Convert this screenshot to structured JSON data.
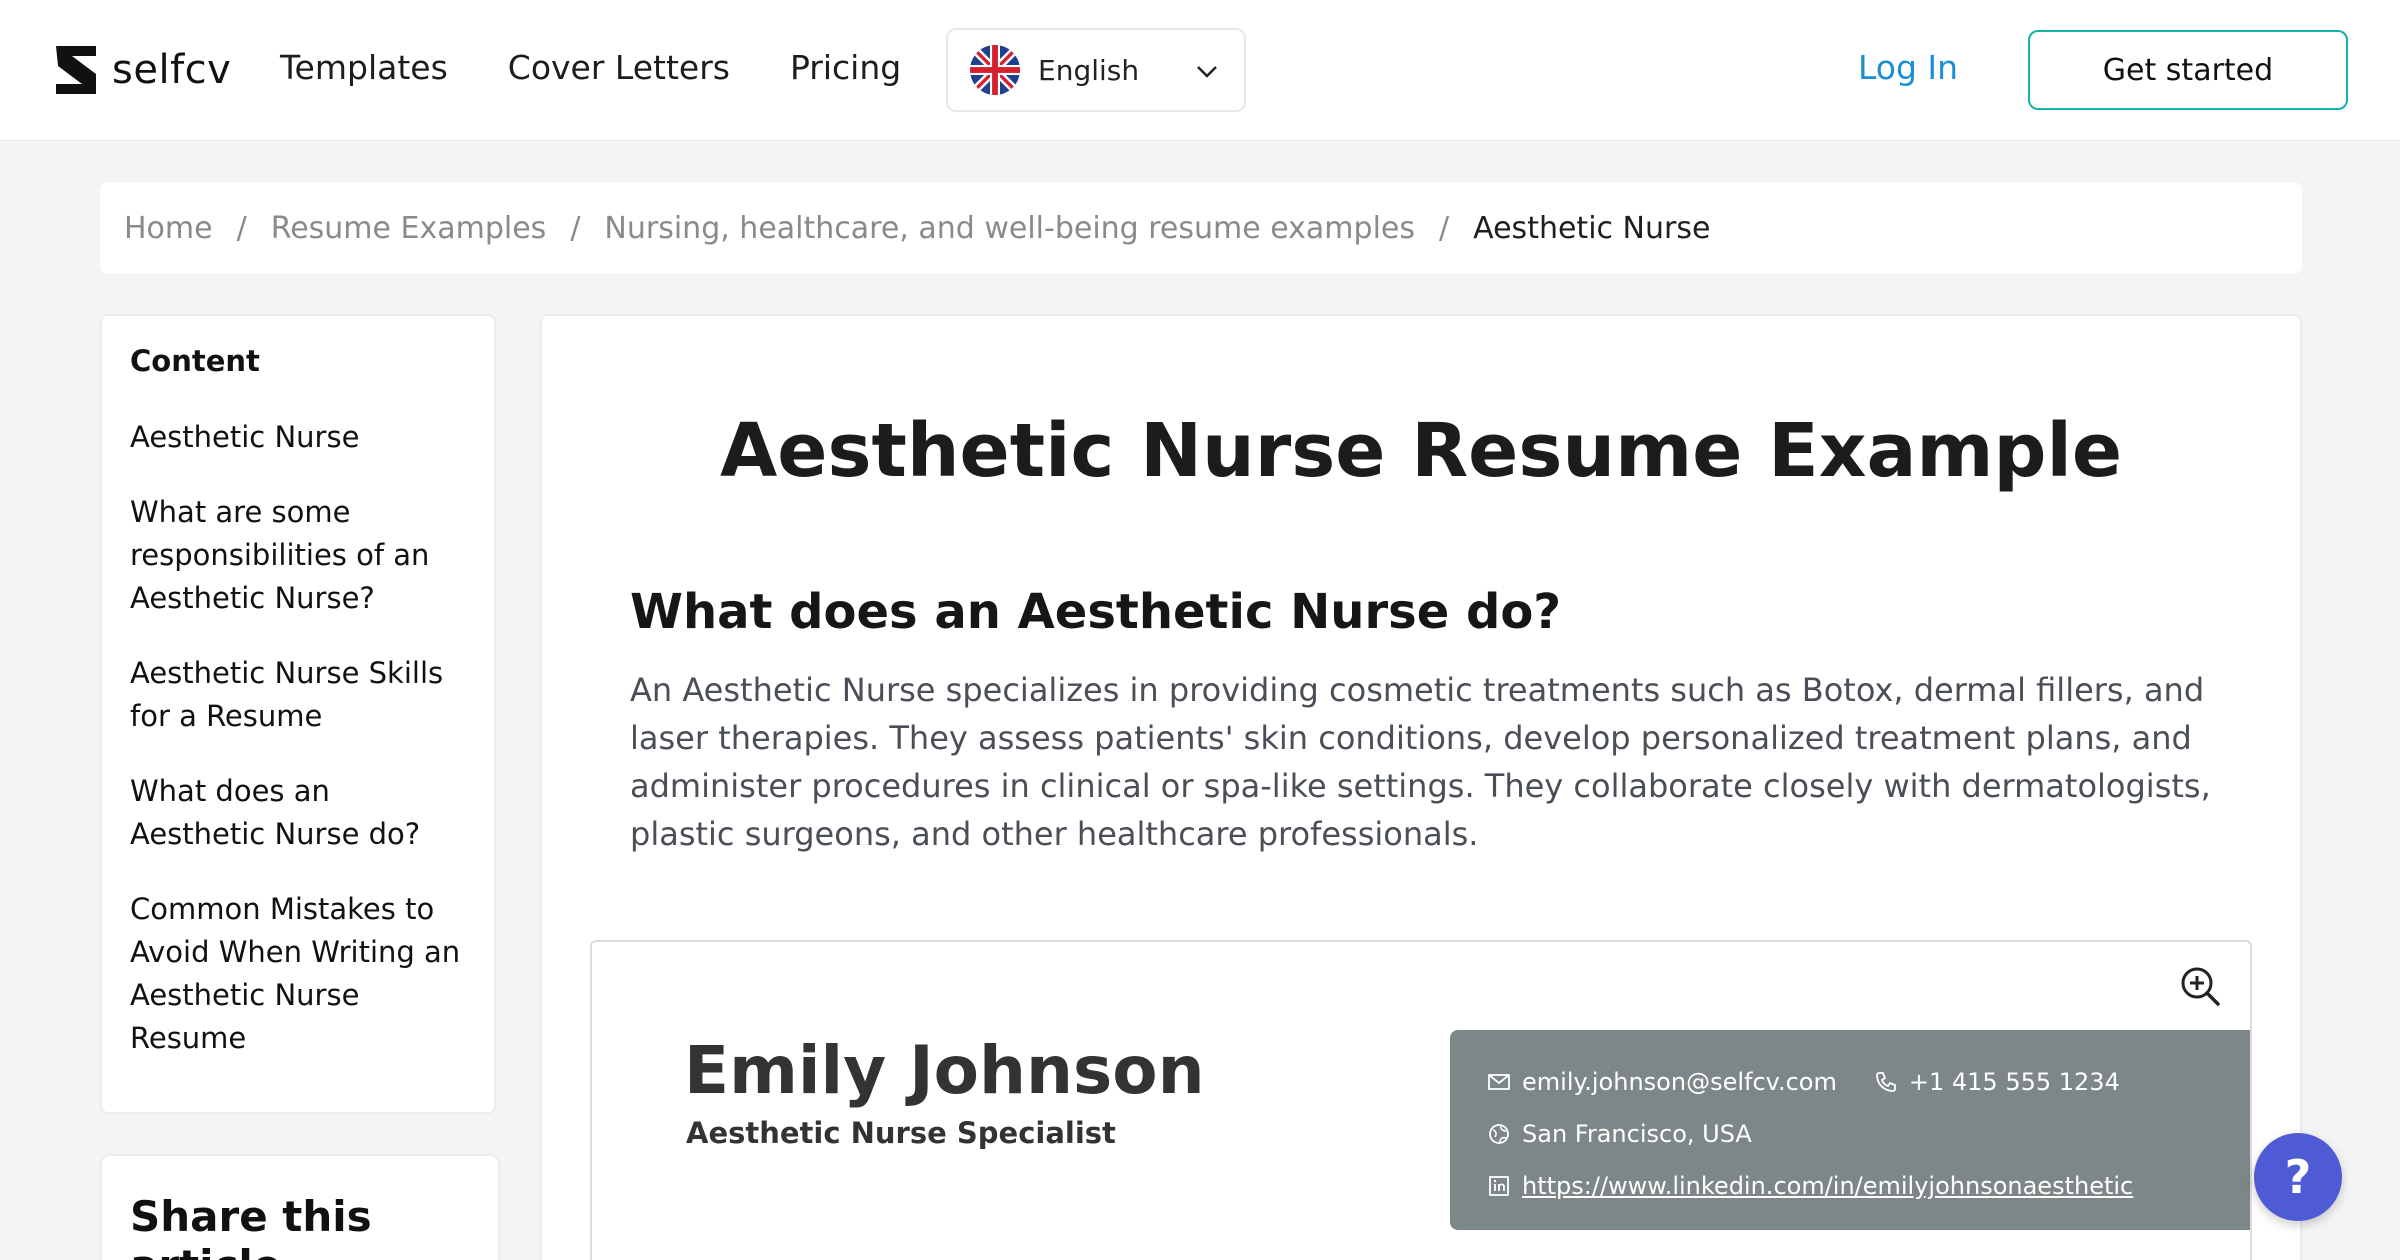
{
  "header": {
    "logo_text": "selfcv",
    "nav": [
      "Templates",
      "Cover Letters",
      "Pricing"
    ],
    "language": "English",
    "login": "Log In",
    "cta": "Get started"
  },
  "breadcrumb": {
    "items": [
      "Home",
      "Resume Examples",
      "Nursing, healthcare, and well-being resume examples"
    ],
    "current": "Aesthetic Nurse"
  },
  "toc": {
    "title": "Content",
    "items": [
      "Aesthetic Nurse",
      "What are some responsibilities of an Aesthetic Nurse?",
      "Aesthetic Nurse Skills for a Resume",
      "What does an Aesthetic Nurse do?",
      "Common Mistakes to Avoid When Writing an Aesthetic Nurse Resume"
    ]
  },
  "share": {
    "title": "Share this article"
  },
  "article": {
    "title": "Aesthetic Nurse Resume Example",
    "heading": "What does an Aesthetic Nurse do?",
    "body": "An Aesthetic Nurse specializes in providing cosmetic treatments such as Botox, dermal fillers, and laser therapies. They assess patients' skin conditions, develop personalized treatment plans, and administer procedures in clinical or spa-like settings. They collaborate closely with dermatologists, plastic surgeons, and other healthcare professionals."
  },
  "resume": {
    "name": "Emily Johnson",
    "role": "Aesthetic Nurse Specialist",
    "email": "emily.johnson@selfcv.com",
    "phone": "+1 415 555 1234",
    "location": "San Francisco, USA",
    "linkedin": "https://www.linkedin.com/in/emilyjohnsonaesthetic"
  },
  "help": {
    "label": "?"
  },
  "colors": {
    "accent": "#1a8fd6",
    "cta_border": "#16b3a8",
    "help_bg": "#4f5bd5",
    "contact_bg": "#7e8788"
  },
  "icons": [
    "logo-icon",
    "uk-flag-icon",
    "chevron-down-icon",
    "zoom-in-icon",
    "mail-icon",
    "phone-icon",
    "location-icon",
    "linkedin-icon",
    "help-icon"
  ]
}
